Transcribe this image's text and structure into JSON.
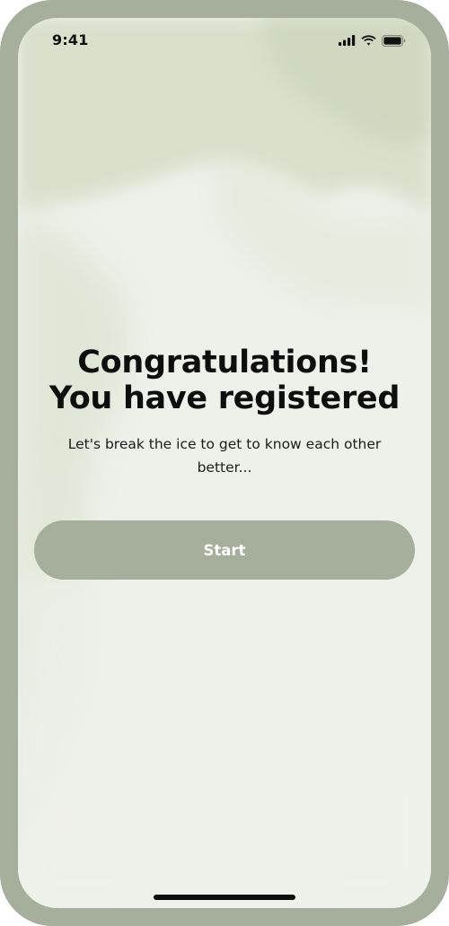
{
  "status_bar": {
    "time": "9:41",
    "icons": [
      "cellular-signal-icon",
      "wifi-icon",
      "battery-icon"
    ]
  },
  "main": {
    "headline_line1": "Congratulations!",
    "headline_line2": "You have registered",
    "subtitle": "Let's break the ice to get to know each other better...",
    "start_label": "Start"
  },
  "colors": {
    "frame": "#a6ae9c",
    "button": "#a6ae9c",
    "screen_background": "#eef1ea",
    "text": "#0e0e0e"
  }
}
